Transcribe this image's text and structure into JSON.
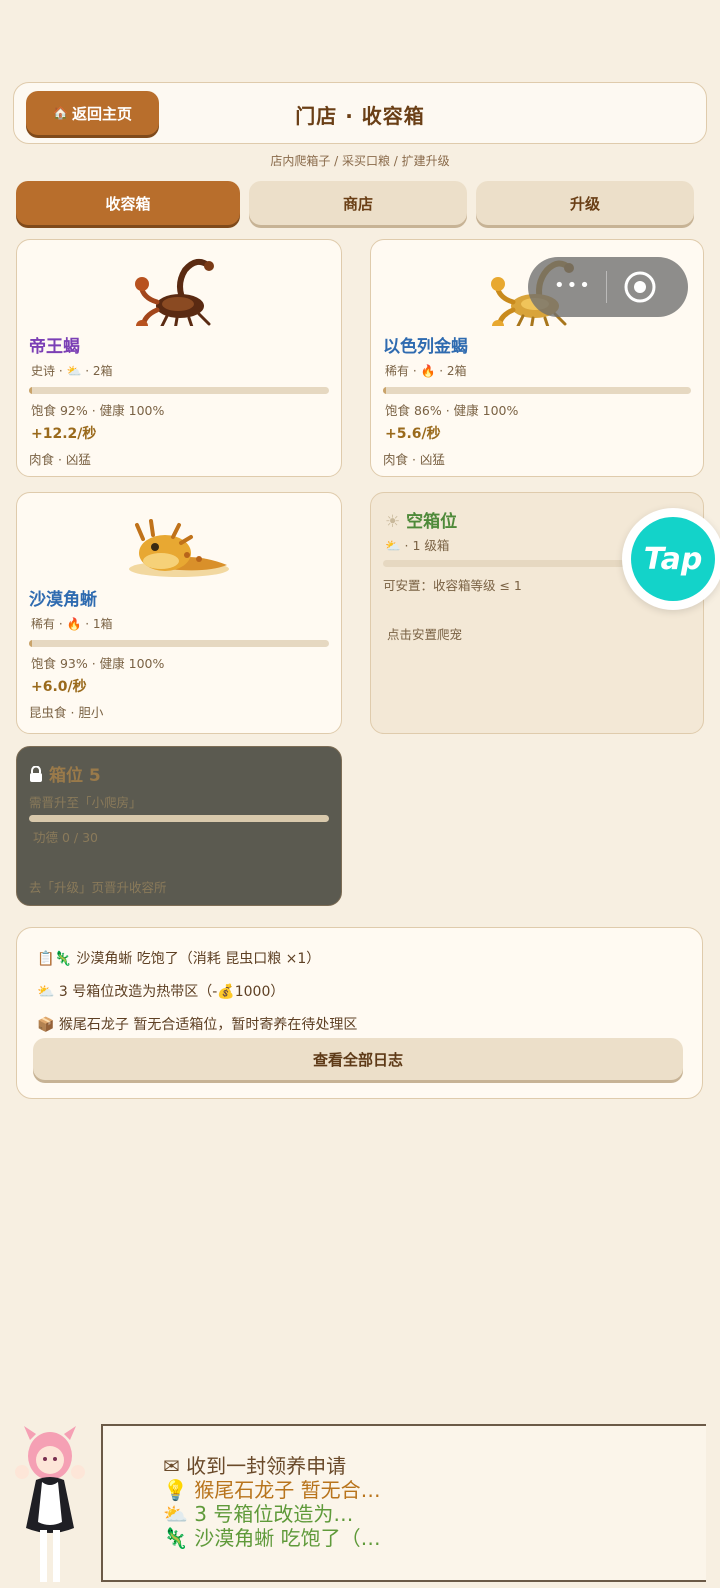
{
  "header": {
    "back_label": "返回主页",
    "title": "门店 · 收容箱",
    "subtitle": "店内爬箱子 / 采买口粮 / 扩建升级"
  },
  "tabs": [
    "收容箱",
    "商店",
    "升级"
  ],
  "slots": [
    {
      "name": "帝王蝎",
      "name_color": "#7b3fb5",
      "meta": "史诗 · ⛅ · 2箱",
      "progress": 0.0,
      "stats": "饱食 92% · 健康 100%",
      "rate": "+12.2/秒",
      "traits": "肉食 · 凶猛",
      "icon": "scorpion-icon"
    },
    {
      "name": "以色列金蝎",
      "name_color": "#2f6bb0",
      "meta": "稀有 · 🔥 · 2箱",
      "progress": 0.0,
      "stats": "饱食 86% · 健康 100%",
      "rate": "+5.6/秒",
      "traits": "肉食 · 凶猛",
      "icon": "golden-scorpion-icon"
    },
    {
      "name": "沙漠角蜥",
      "name_color": "#2f6bb0",
      "meta": "稀有 · 🔥 · 1箱",
      "progress": 0.0,
      "stats": "饱食 93% · 健康 100%",
      "rate": "+6.0/秒",
      "traits": "昆虫食 · 胆小",
      "icon": "horned-lizard-icon"
    }
  ],
  "empty_slot": {
    "title": "空箱位",
    "meta": "⛅ · 1 级箱",
    "condition": "可安置：收容箱等级 ≤ 1",
    "action": "点击安置爬宠"
  },
  "locked_slot": {
    "title": "箱位 5",
    "requirement": "需晋升至「小爬房」",
    "merit": "功德 0 / 30",
    "hint": "去「升级」页晋升收容所"
  },
  "log": {
    "lines": [
      "📋🦎 沙漠角蜥 吃饱了（消耗 昆虫口粮 ×1）",
      "⛅ 3 号箱位改造为热带区（-💰1000）",
      "📦 猴尾石龙子 暂无合适箱位，暂时寄养在待处理区"
    ],
    "button": "查看全部日志"
  },
  "dialog": {
    "lines": [
      "✉ 收到一封领养申请",
      "💡 猴尾石龙子 暂无合…",
      "⛅ 3 号箱位改造为…",
      "🦎 沙漠角蜥 吃饱了（…"
    ],
    "colors": [
      "#6a4a2a",
      "#b8741c",
      "#5f9a3a",
      "#5f9a3a"
    ]
  },
  "badge": {
    "label": "Tap"
  },
  "colors": {
    "accent": "#b86e2c",
    "background": "#f7efe1"
  }
}
